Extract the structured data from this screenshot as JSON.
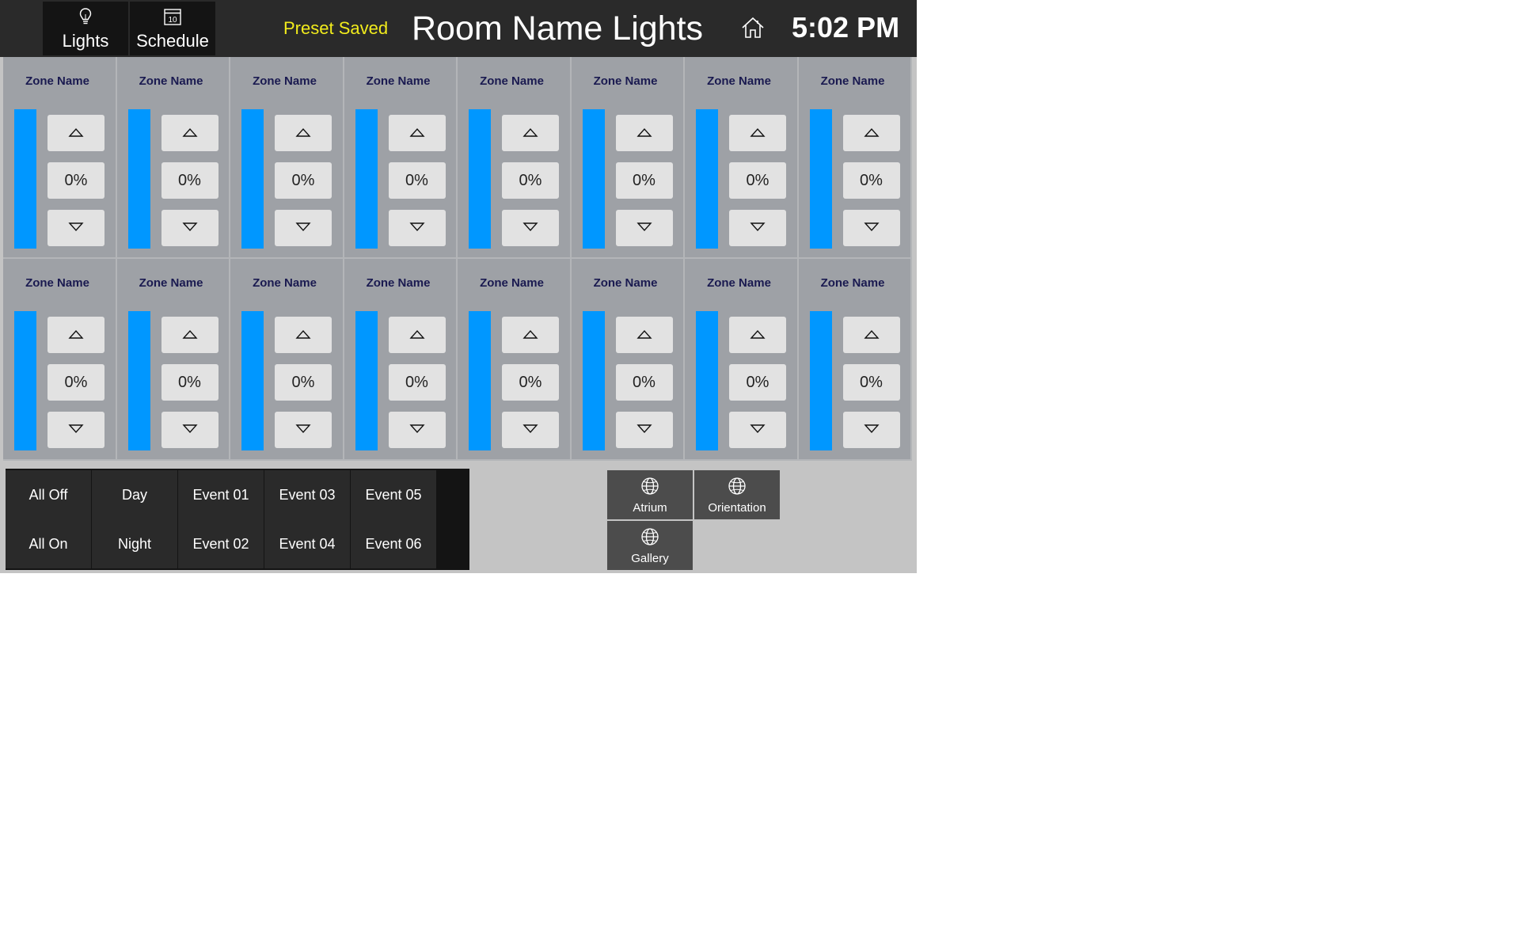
{
  "nav": {
    "lights_label": "Lights",
    "lights_icon": "lightbulb-icon",
    "schedule_label": "Schedule",
    "schedule_icon": "calendar-icon",
    "schedule_icon_day": "10"
  },
  "header": {
    "preset_status": "Preset Saved",
    "room_title": "Room Name Lights",
    "home_icon": "home-icon",
    "clock": "5:02 PM"
  },
  "zones": [
    {
      "name": "Zone Name",
      "level": "0%"
    },
    {
      "name": "Zone Name",
      "level": "0%"
    },
    {
      "name": "Zone Name",
      "level": "0%"
    },
    {
      "name": "Zone Name",
      "level": "0%"
    },
    {
      "name": "Zone Name",
      "level": "0%"
    },
    {
      "name": "Zone Name",
      "level": "0%"
    },
    {
      "name": "Zone Name",
      "level": "0%"
    },
    {
      "name": "Zone Name",
      "level": "0%"
    },
    {
      "name": "Zone Name",
      "level": "0%"
    },
    {
      "name": "Zone Name",
      "level": "0%"
    },
    {
      "name": "Zone Name",
      "level": "0%"
    },
    {
      "name": "Zone Name",
      "level": "0%"
    },
    {
      "name": "Zone Name",
      "level": "0%"
    },
    {
      "name": "Zone Name",
      "level": "0%"
    },
    {
      "name": "Zone Name",
      "level": "0%"
    },
    {
      "name": "Zone Name",
      "level": "0%"
    }
  ],
  "presets": [
    "All Off",
    "Day",
    "Event 01",
    "Event 03",
    "Event 05",
    "All On",
    "Night",
    "Event 02",
    "Event 04",
    "Event 06"
  ],
  "rooms": [
    {
      "label": "Atrium",
      "icon": "globe-icon"
    },
    {
      "label": "Orientation",
      "icon": "globe-icon"
    },
    {
      "label": "Gallery",
      "icon": "globe-icon"
    }
  ],
  "colors": {
    "topbar": "#2a2a2a",
    "nav_button": "#141414",
    "preset_status": "#f2ec1c",
    "zone_panel": "#9ea1a6",
    "level_bar": "#0097ff",
    "zone_button": "#e2e2e2",
    "room_button": "#4c4c4c"
  }
}
